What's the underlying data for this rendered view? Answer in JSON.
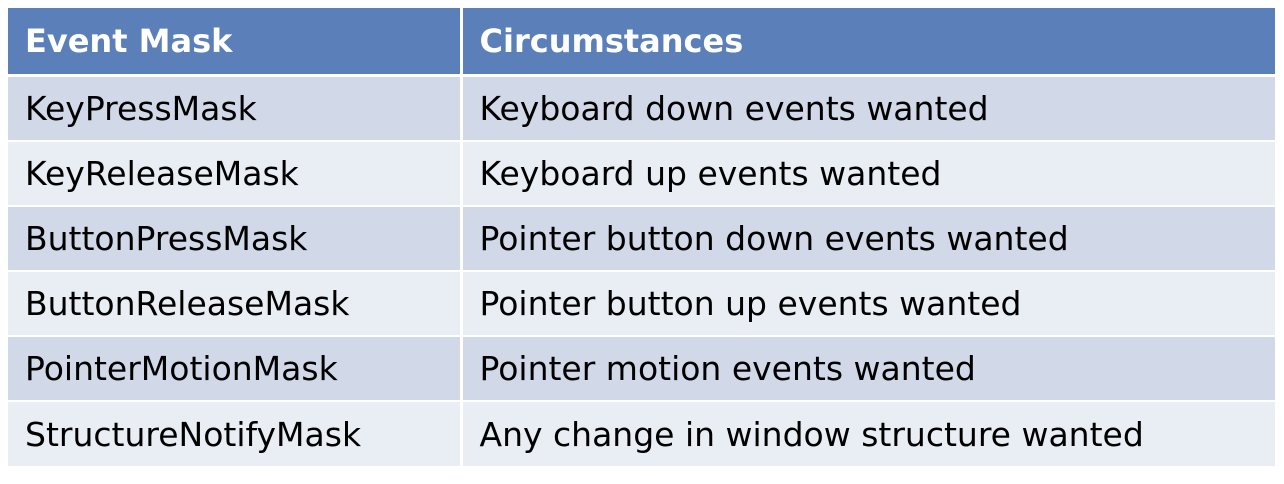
{
  "table": {
    "headers": [
      "Event Mask",
      "Circumstances"
    ],
    "rows": [
      [
        "KeyPressMask",
        "Keyboard down events wanted"
      ],
      [
        "KeyReleaseMask",
        "Keyboard up events wanted"
      ],
      [
        "ButtonPressMask",
        "Pointer button down events wanted"
      ],
      [
        "ButtonReleaseMask",
        "Pointer button up events wanted"
      ],
      [
        "PointerMotionMask",
        "Pointer motion events wanted"
      ],
      [
        "StructureNotifyMask",
        "Any change in window structure wanted"
      ]
    ]
  },
  "colors": {
    "header_bg": "#5b7fb9",
    "row_odd_bg": "#d1d8e7",
    "row_even_bg": "#e9edf4"
  }
}
